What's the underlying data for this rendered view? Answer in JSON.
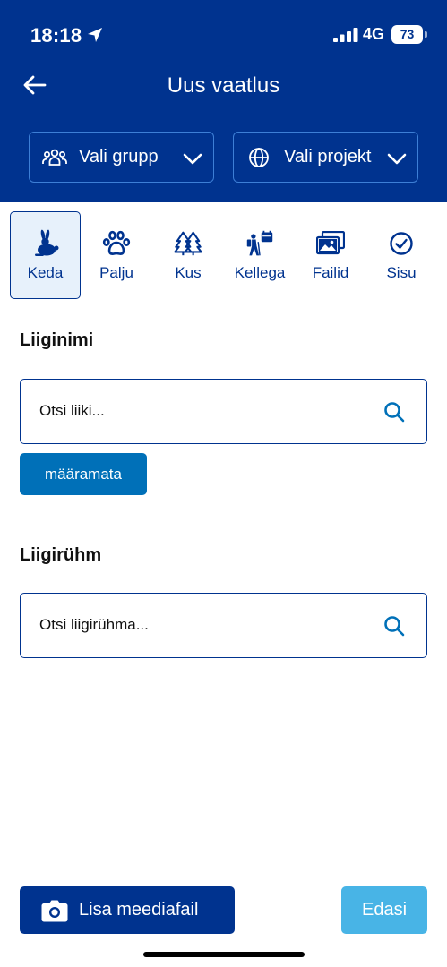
{
  "status_bar": {
    "time": "18:18",
    "network": "4G",
    "battery": "73"
  },
  "header": {
    "title": "Uus vaatlus",
    "group_select": "Vali grupp",
    "project_select": "Vali projekt"
  },
  "tabs": [
    {
      "label": "Keda",
      "icon": "rabbit-icon",
      "active": true
    },
    {
      "label": "Palju",
      "icon": "paw-icon",
      "active": false
    },
    {
      "label": "Kus",
      "icon": "trees-icon",
      "active": false
    },
    {
      "label": "Kellega",
      "icon": "hiker-calendar-icon",
      "active": false
    },
    {
      "label": "Failid",
      "icon": "images-icon",
      "active": false
    },
    {
      "label": "Sisu",
      "icon": "check-circle-icon",
      "active": false
    }
  ],
  "form": {
    "species_label": "Liiginimi",
    "species_placeholder": "Otsi liiki...",
    "undetermined_chip": "määramata",
    "group_label": "Liigirühm",
    "group_placeholder": "Otsi liigirühma..."
  },
  "footer": {
    "media_button": "Lisa meediafail",
    "next_button": "Edasi"
  },
  "colors": {
    "header_bg": "#00338f",
    "accent": "#0070b8",
    "next_disabled": "#48b4e6",
    "active_tab_bg": "#e7f1fb"
  }
}
